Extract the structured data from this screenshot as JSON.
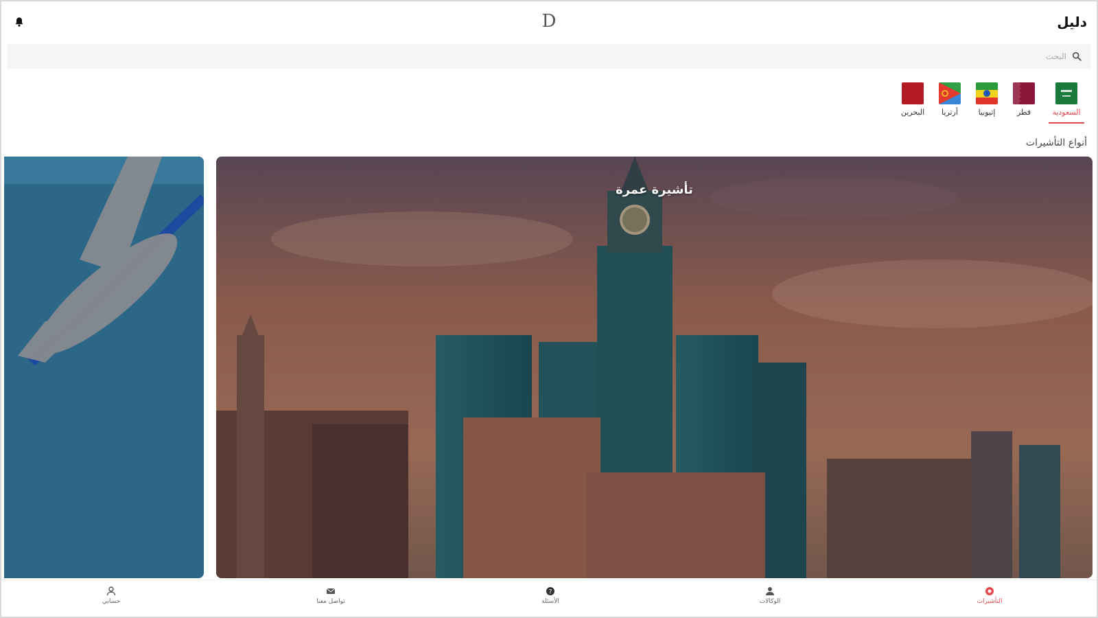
{
  "header": {
    "title": "دليل",
    "logo_letter": "D",
    "bell_icon": "bell-icon"
  },
  "search": {
    "placeholder": "البحث",
    "value": "",
    "icon": "search-icon"
  },
  "countries": [
    {
      "label": "السعودية",
      "flag": "saudi-flag",
      "active": true
    },
    {
      "label": "قطر",
      "flag": "qatar-flag",
      "active": false
    },
    {
      "label": "إثيوبيا",
      "flag": "ethiopia-flag",
      "active": false
    },
    {
      "label": "أرتريا",
      "flag": "eritrea-flag",
      "active": false
    },
    {
      "label": "البحرين",
      "flag": "bahrain-flag",
      "active": false
    }
  ],
  "section": {
    "title": "أنواع التأشيرات"
  },
  "cards": [
    {
      "caption": "تأشيرة عمرة",
      "image": "makkah-clock-tower-image"
    },
    {
      "caption": "",
      "image": "airplane-illustration"
    }
  ],
  "bottom_nav": [
    {
      "label": "التأشيرات",
      "icon": "visa-icon",
      "active": true
    },
    {
      "label": "الوكالات",
      "icon": "agency-icon",
      "active": false
    },
    {
      "label": "الأسئلة",
      "icon": "question-icon",
      "active": false
    },
    {
      "label": "تواصل معنا",
      "icon": "contact-icon",
      "active": false
    },
    {
      "label": "حسابي",
      "icon": "account-icon",
      "active": false
    }
  ],
  "colors": {
    "accent": "#e5484d",
    "side_card": "#2f6d8f"
  }
}
